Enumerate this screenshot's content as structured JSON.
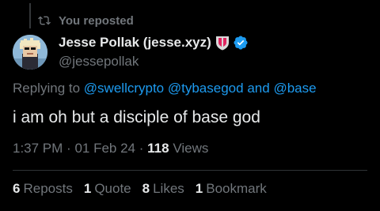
{
  "repost": {
    "icon": "repost-icon",
    "label": "You reposted"
  },
  "author": {
    "display_name": "Jesse Pollak (jesse.xyz)",
    "handle": "@jessepollak",
    "avatar": "pixel-avatar",
    "shield_badge": "shield-badge-icon",
    "verified_badge": "verified-badge-icon",
    "verified_color": "#1d9bf0"
  },
  "reply": {
    "prefix": "Replying to",
    "mention1": "@swellcrypto",
    "mention2": "@tybasegod",
    "joiner": "and",
    "mention3": "@base"
  },
  "tweet": {
    "text": "i am oh but a disciple of base god"
  },
  "meta": {
    "time": "1:37 PM",
    "sep1": "·",
    "date": "01 Feb 24",
    "sep2": "·",
    "views_count": "118",
    "views_label": "Views"
  },
  "stats": {
    "reposts_count": "6",
    "reposts_label": "Reposts",
    "quotes_count": "1",
    "quotes_label": "Quote",
    "likes_count": "8",
    "likes_label": "Likes",
    "bookmarks_count": "1",
    "bookmarks_label": "Bookmark"
  },
  "colors": {
    "background": "#000000",
    "primary_text": "#e7e9ea",
    "secondary_text": "#71767b",
    "link": "#1d9bf0",
    "divider": "#2f3336"
  }
}
